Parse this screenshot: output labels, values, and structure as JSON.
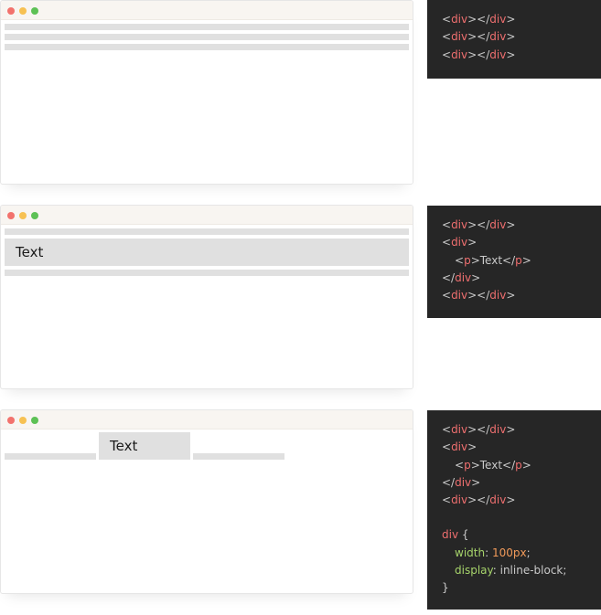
{
  "examples": [
    {
      "code_lines": [
        [
          {
            "t": "<",
            "c": "punc"
          },
          {
            "t": "div",
            "c": "tag"
          },
          {
            "t": "></",
            "c": "punc"
          },
          {
            "t": "div",
            "c": "tag"
          },
          {
            "t": ">",
            "c": "punc"
          }
        ],
        [
          {
            "t": "<",
            "c": "punc"
          },
          {
            "t": "div",
            "c": "tag"
          },
          {
            "t": "></",
            "c": "punc"
          },
          {
            "t": "div",
            "c": "tag"
          },
          {
            "t": ">",
            "c": "punc"
          }
        ],
        [
          {
            "t": "<",
            "c": "punc"
          },
          {
            "t": "div",
            "c": "tag"
          },
          {
            "t": "></",
            "c": "punc"
          },
          {
            "t": "div",
            "c": "tag"
          },
          {
            "t": ">",
            "c": "punc"
          }
        ]
      ]
    },
    {
      "preview_text": "Text",
      "code_lines": [
        [
          {
            "t": "<",
            "c": "punc"
          },
          {
            "t": "div",
            "c": "tag"
          },
          {
            "t": "></",
            "c": "punc"
          },
          {
            "t": "div",
            "c": "tag"
          },
          {
            "t": ">",
            "c": "punc"
          }
        ],
        [
          {
            "t": "<",
            "c": "punc"
          },
          {
            "t": "div",
            "c": "tag"
          },
          {
            "t": ">",
            "c": "punc"
          }
        ],
        [
          {
            "t": "<",
            "c": "punc",
            "i": 1
          },
          {
            "t": "p",
            "c": "tag"
          },
          {
            "t": ">",
            "c": "punc"
          },
          {
            "t": "Text",
            "c": "txt"
          },
          {
            "t": "</",
            "c": "punc"
          },
          {
            "t": "p",
            "c": "tag"
          },
          {
            "t": ">",
            "c": "punc"
          }
        ],
        [
          {
            "t": "</",
            "c": "punc"
          },
          {
            "t": "div",
            "c": "tag"
          },
          {
            "t": ">",
            "c": "punc"
          }
        ],
        [
          {
            "t": "<",
            "c": "punc"
          },
          {
            "t": "div",
            "c": "tag"
          },
          {
            "t": "></",
            "c": "punc"
          },
          {
            "t": "div",
            "c": "tag"
          },
          {
            "t": ">",
            "c": "punc"
          }
        ]
      ]
    },
    {
      "preview_text": "Text",
      "code_lines": [
        [
          {
            "t": "<",
            "c": "punc"
          },
          {
            "t": "div",
            "c": "tag"
          },
          {
            "t": "></",
            "c": "punc"
          },
          {
            "t": "div",
            "c": "tag"
          },
          {
            "t": ">",
            "c": "punc"
          }
        ],
        [
          {
            "t": "<",
            "c": "punc"
          },
          {
            "t": "div",
            "c": "tag"
          },
          {
            "t": ">",
            "c": "punc"
          }
        ],
        [
          {
            "t": "<",
            "c": "punc",
            "i": 1
          },
          {
            "t": "p",
            "c": "tag"
          },
          {
            "t": ">",
            "c": "punc"
          },
          {
            "t": "Text",
            "c": "txt"
          },
          {
            "t": "</",
            "c": "punc"
          },
          {
            "t": "p",
            "c": "tag"
          },
          {
            "t": ">",
            "c": "punc"
          }
        ],
        [
          {
            "t": "</",
            "c": "punc"
          },
          {
            "t": "div",
            "c": "tag"
          },
          {
            "t": ">",
            "c": "punc"
          }
        ],
        [
          {
            "t": "<",
            "c": "punc"
          },
          {
            "t": "div",
            "c": "tag"
          },
          {
            "t": "></",
            "c": "punc"
          },
          {
            "t": "div",
            "c": "tag"
          },
          {
            "t": ">",
            "c": "punc"
          }
        ],
        [],
        [
          {
            "t": "div",
            "c": "tag"
          },
          {
            "t": " {",
            "c": "punc"
          }
        ],
        [
          {
            "t": "width",
            "c": "prop",
            "i": 1
          },
          {
            "t": ": ",
            "c": "punc"
          },
          {
            "t": "100px",
            "c": "num"
          },
          {
            "t": ";",
            "c": "punc"
          }
        ],
        [
          {
            "t": "display",
            "c": "prop",
            "i": 1
          },
          {
            "t": ": ",
            "c": "punc"
          },
          {
            "t": "inline-block",
            "c": "val"
          },
          {
            "t": ";",
            "c": "punc"
          }
        ],
        [
          {
            "t": "}",
            "c": "punc"
          }
        ]
      ]
    }
  ],
  "colors": {
    "code_bg": "#262626",
    "tag": "#ef6f6f",
    "property": "#a6d36b",
    "number": "#f19a5a",
    "block": "#e0e0e0"
  }
}
